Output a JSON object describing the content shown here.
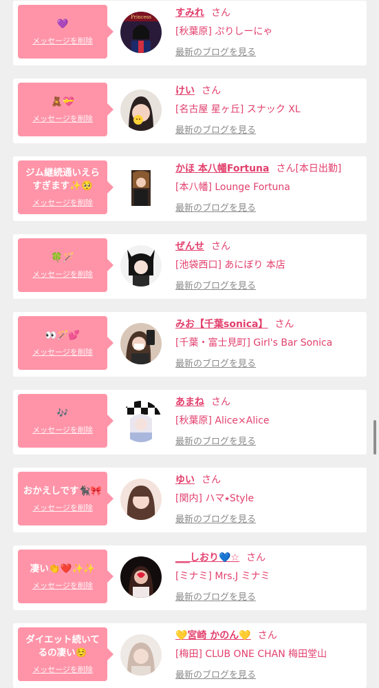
{
  "delete_label": "メッセージを削除",
  "blog_label": "最新のブログを見る",
  "san_label": "さん",
  "colors": {
    "accent": "#e23f6c",
    "bubble": "#ff94a8",
    "background": "#efefef",
    "link_gray": "#8a8a8a"
  },
  "entries": [
    {
      "message": "💜",
      "name": "すみれ",
      "suffix": "",
      "shop": "[秋葉原] ぷりしーにゃ",
      "avatar_label": "Princess"
    },
    {
      "message": "🧸💝",
      "name": "けい",
      "suffix": "",
      "shop": "[名古屋 星ヶ丘] スナック XL"
    },
    {
      "message": "ジム継続通いえらすぎます✨🥺",
      "name": "かほ 本八幡Fortuna",
      "suffix": "[本日出勤]",
      "shop": "[本八幡] Lounge Fortuna"
    },
    {
      "message": "🍀🪄",
      "name": "ぜんせ",
      "suffix": "",
      "shop": "[池袋西口] あにぼり 本店"
    },
    {
      "message": "👀🪄💕",
      "name": "みお【千葉sonica】",
      "suffix": "",
      "shop": "[千葉・富士見町] Girl's Bar Sonica"
    },
    {
      "message": "🎶",
      "name": "あまね",
      "suffix": "",
      "shop": "[秋葉原] Alice×Alice"
    },
    {
      "message": "おかえしです🐈‍⬛🎀",
      "name": "ゆい",
      "suffix": "",
      "shop": "[関内] ハマ⭑Style"
    },
    {
      "message": "凄い👏❤️✨✨",
      "name": "___しおり💙☆",
      "suffix": "",
      "shop": "[ミナミ] Mrs.J ミナミ"
    },
    {
      "message": "ダイエット続いてるの凄い☺️",
      "name": "💛宮崎 かのん💛",
      "suffix": "",
      "shop": "[梅田] CLUB ONE CHAN 梅田堂山"
    }
  ]
}
